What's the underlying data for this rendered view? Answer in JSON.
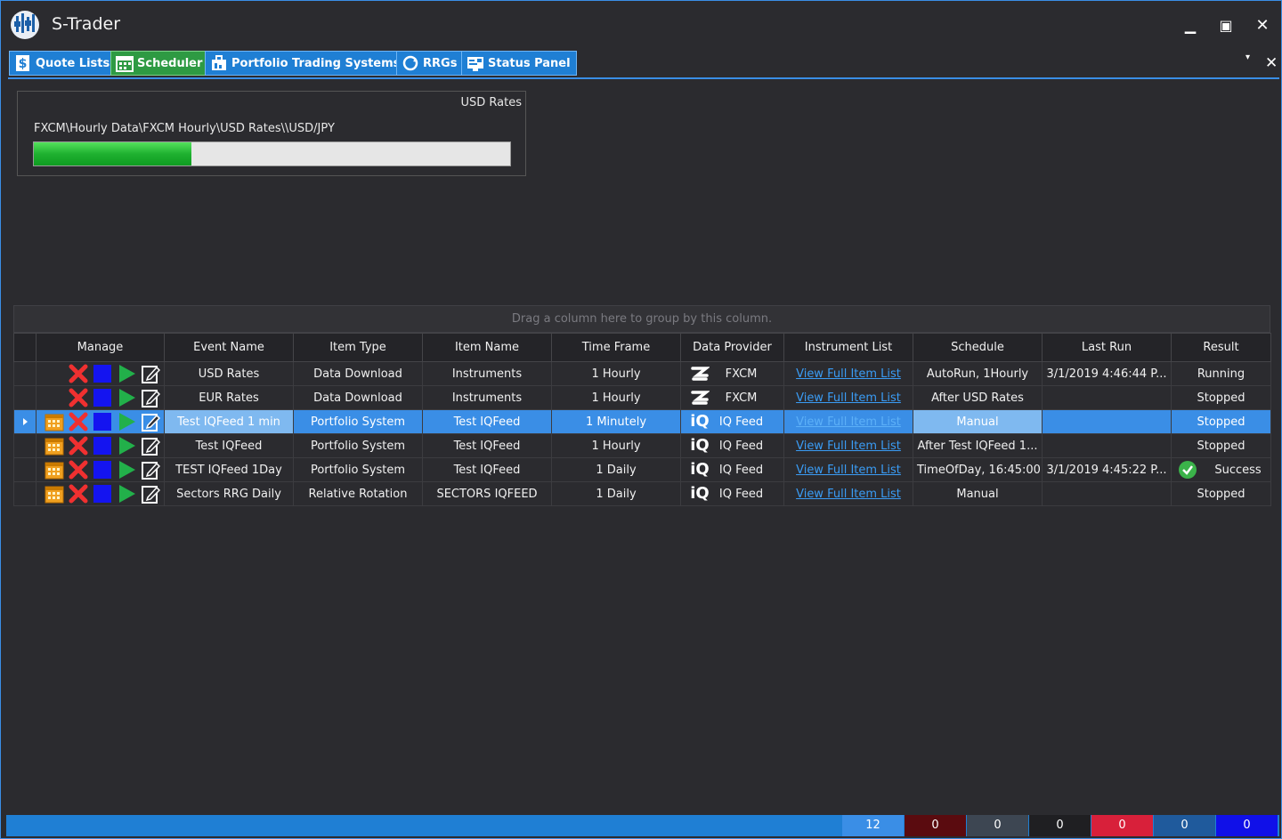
{
  "app": {
    "title": "S-Trader"
  },
  "window_controls": {
    "minimize": "🗕",
    "maximize": "🗖",
    "close": "✕"
  },
  "tabs": [
    {
      "label": "Quote Lists",
      "icon": "quote-list-icon",
      "active": false
    },
    {
      "label": "Scheduler",
      "icon": "calendar-icon",
      "active": true
    },
    {
      "label": "Portfolio Trading Systems",
      "icon": "portfolio-icon",
      "active": false
    },
    {
      "label": "RRGs",
      "icon": "rotation-icon",
      "active": false
    },
    {
      "label": "Status Panel",
      "icon": "status-panel-icon",
      "active": false
    }
  ],
  "tab_strip": {
    "menu_glyph": "▾",
    "close_glyph": "✕"
  },
  "progress": {
    "title": "USD Rates",
    "path": "FXCM\\Hourly Data\\FXCM Hourly\\USD Rates\\\\USD/JPY",
    "fraction": 0.33
  },
  "grid": {
    "group_hint": "Drag a column here to group by this column.",
    "columns": [
      "Manage",
      "Event Name",
      "Item Type",
      "Item Name",
      "Time Frame",
      "Data Provider",
      "Instrument List",
      "Schedule",
      "Last Run",
      "Result"
    ],
    "rows": [
      {
        "calendar": false,
        "event": "USD Rates",
        "item_type": "Data Download",
        "item_name": "Instruments",
        "time_frame": "1 Hourly",
        "provider_icon": "fxcm-icon",
        "provider": "FXCM",
        "instrument_list": "View Full Item List",
        "schedule": "AutoRun, 1Hourly",
        "last_run": "3/1/2019 4:46:44 P...",
        "result": "Running",
        "result_icon": "",
        "selected": false
      },
      {
        "calendar": false,
        "event": "EUR Rates",
        "item_type": "Data Download",
        "item_name": "Instruments",
        "time_frame": "1 Hourly",
        "provider_icon": "fxcm-icon",
        "provider": "FXCM",
        "instrument_list": "View Full Item List",
        "schedule": "After USD Rates",
        "last_run": "",
        "result": "Stopped",
        "result_icon": "",
        "selected": false
      },
      {
        "calendar": true,
        "event": "Test IQFeed 1 min",
        "item_type": "Portfolio System",
        "item_name": "Test IQFeed",
        "time_frame": "1 Minutely",
        "provider_icon": "iqfeed-icon",
        "provider": "IQ Feed",
        "instrument_list": "View Full Item List",
        "schedule": "Manual",
        "last_run": "",
        "result": "Stopped",
        "result_icon": "",
        "selected": true
      },
      {
        "calendar": true,
        "event": "Test IQFeed",
        "item_type": "Portfolio System",
        "item_name": "Test IQFeed",
        "time_frame": "1 Hourly",
        "provider_icon": "iqfeed-icon",
        "provider": "IQ Feed",
        "instrument_list": "View Full Item List",
        "schedule": "After Test IQFeed 1...",
        "last_run": "",
        "result": "Stopped",
        "result_icon": "",
        "selected": false
      },
      {
        "calendar": true,
        "event": "TEST IQFeed 1Day",
        "item_type": "Portfolio System",
        "item_name": "Test IQFeed",
        "time_frame": "1 Daily",
        "provider_icon": "iqfeed-icon",
        "provider": "IQ Feed",
        "instrument_list": "View Full Item List",
        "schedule": "TimeOfDay, 16:45:00",
        "last_run": "3/1/2019 4:45:22 P...",
        "result": "Success",
        "result_icon": "check-icon",
        "selected": false
      },
      {
        "calendar": true,
        "event": "Sectors RRG Daily",
        "item_type": "Relative Rotation",
        "item_name": "SECTORS IQFEED",
        "time_frame": "1 Daily",
        "provider_icon": "iqfeed-icon",
        "provider": "IQ Feed",
        "instrument_list": "View Full Item List",
        "schedule": "Manual",
        "last_run": "",
        "result": "Stopped",
        "result_icon": "",
        "selected": false
      }
    ]
  },
  "status_bar": {
    "counters": [
      {
        "value": "12",
        "color": "#3a8ee6"
      },
      {
        "value": "0",
        "color": "#5a0b0f"
      },
      {
        "value": "0",
        "color": "#3d4652"
      },
      {
        "value": "0",
        "color": "#1f1f22"
      },
      {
        "value": "0",
        "color": "#d8203a"
      },
      {
        "value": "0",
        "color": "#1f5a9c"
      },
      {
        "value": "0",
        "color": "#1010e8"
      }
    ]
  },
  "colors": {
    "accent": "#3a8ee6",
    "tab": "#1f7fd4",
    "active_tab": "#2e9a43",
    "progress": "#1fb130"
  }
}
